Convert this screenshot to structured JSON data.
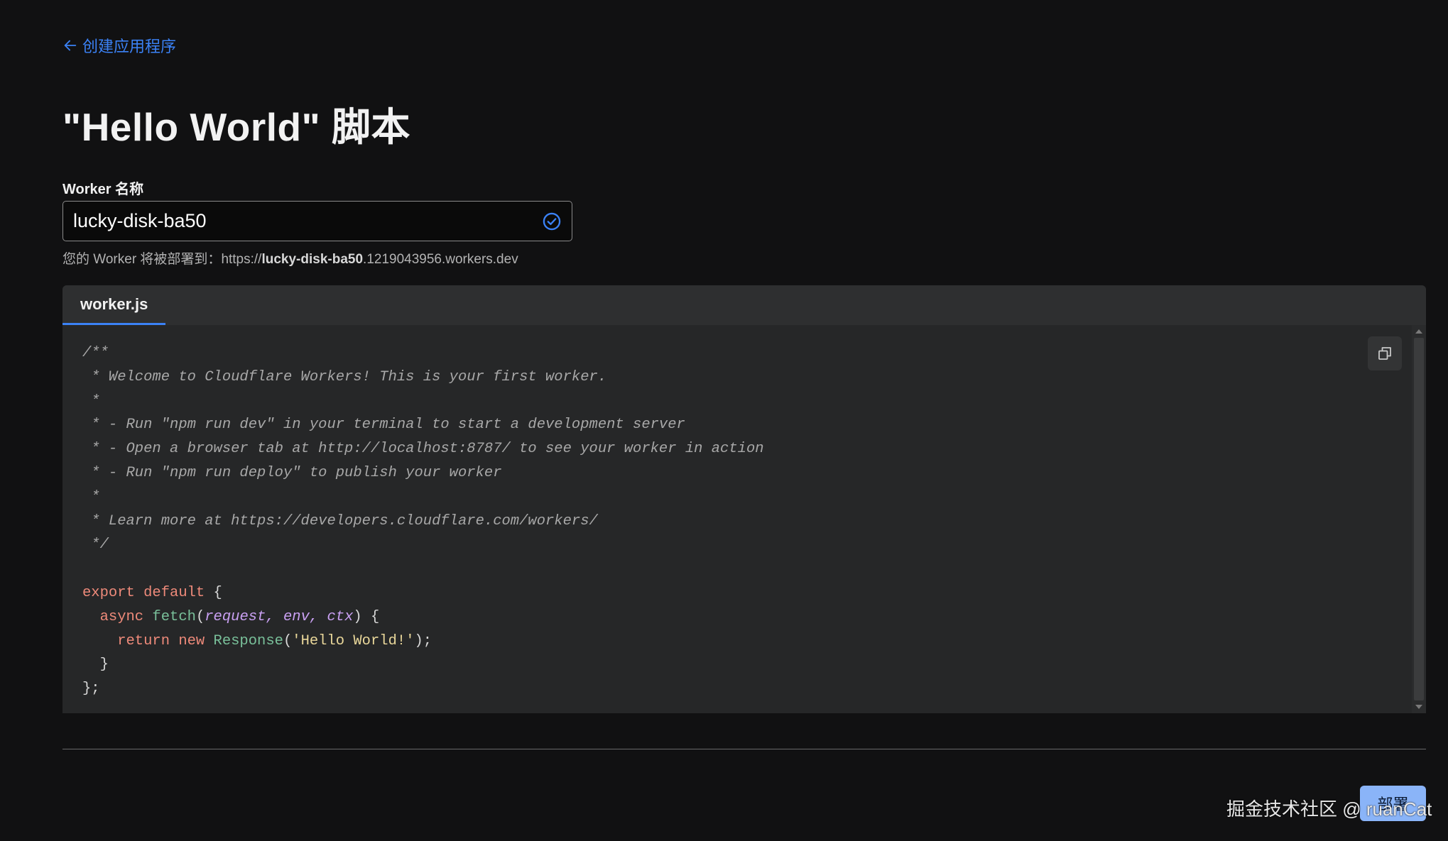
{
  "back_link": {
    "label": "创建应用程序"
  },
  "title": "\"Hello World\" 脚本",
  "worker_name": {
    "label": "Worker 名称",
    "value": "lucky-disk-ba50",
    "hint_prefix": "您的 Worker 将被部署到：",
    "hint_url_scheme": "https://",
    "hint_url_name": "lucky-disk-ba50",
    "hint_url_suffix": ".1219043956.workers.dev"
  },
  "editor": {
    "tab_label": "worker.js",
    "code_lines": [
      [
        {
          "t": "/**",
          "c": "com"
        }
      ],
      [
        {
          "t": " * Welcome to Cloudflare Workers! This is your first worker.",
          "c": "com"
        }
      ],
      [
        {
          "t": " *",
          "c": "com"
        }
      ],
      [
        {
          "t": " * - Run \"npm run dev\" in your terminal to start a development server",
          "c": "com"
        }
      ],
      [
        {
          "t": " * - Open a browser tab at http://localhost:8787/ to see your worker in action",
          "c": "com"
        }
      ],
      [
        {
          "t": " * - Run \"npm run deploy\" to publish your worker",
          "c": "com"
        }
      ],
      [
        {
          "t": " *",
          "c": "com"
        }
      ],
      [
        {
          "t": " * Learn more at https://developers.cloudflare.com/workers/",
          "c": "com"
        }
      ],
      [
        {
          "t": " */",
          "c": "com"
        }
      ],
      [
        {
          "t": "",
          "c": "punc"
        }
      ],
      [
        {
          "t": "export default",
          "c": "kw"
        },
        {
          "t": " {",
          "c": "punc"
        }
      ],
      [
        {
          "t": "  async ",
          "c": "kw"
        },
        {
          "t": "fetch",
          "c": "fn"
        },
        {
          "t": "(",
          "c": "punc"
        },
        {
          "t": "request, env, ctx",
          "c": "param"
        },
        {
          "t": ") {",
          "c": "punc"
        }
      ],
      [
        {
          "t": "    return new ",
          "c": "kw"
        },
        {
          "t": "Response",
          "c": "fn"
        },
        {
          "t": "(",
          "c": "punc"
        },
        {
          "t": "'Hello World!'",
          "c": "str"
        },
        {
          "t": ");",
          "c": "punc"
        }
      ],
      [
        {
          "t": "  }",
          "c": "punc"
        }
      ],
      [
        {
          "t": "};",
          "c": "punc"
        }
      ]
    ]
  },
  "deploy_button": {
    "label": "部署"
  },
  "watermark": "掘金技术社区 @ ruanCat",
  "colors": {
    "accent": "#3b82f6",
    "background": "#111112",
    "editor_bg": "#262728",
    "button_bg": "#8ab4f8"
  },
  "icons": {
    "back": "arrow-left-icon",
    "valid": "check-circle-icon",
    "copy": "copy-icon"
  }
}
